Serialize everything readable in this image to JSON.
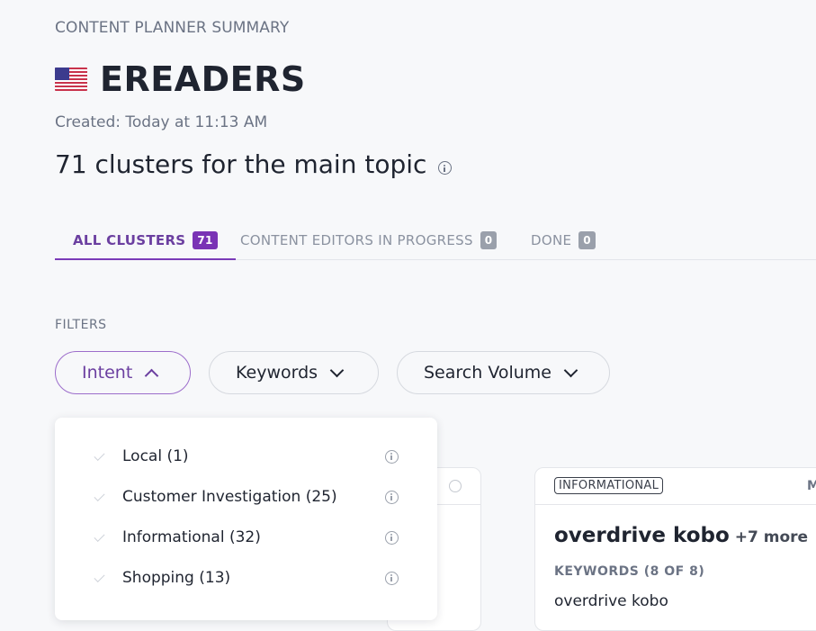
{
  "header": {
    "summary_label": "CONTENT PLANNER SUMMARY",
    "flag_icon": "us-flag-icon",
    "title": "EREADERS",
    "created": "Created: Today at 11:13 AM",
    "clusters_heading": "71 clusters for the main topic"
  },
  "tabs": [
    {
      "label": "ALL CLUSTERS",
      "count": "71",
      "active": true
    },
    {
      "label": "CONTENT EDITORS IN PROGRESS",
      "count": "0",
      "active": false
    },
    {
      "label": "DONE",
      "count": "0",
      "active": false
    }
  ],
  "filters": {
    "label": "FILTERS",
    "buttons": [
      {
        "label": "Intent",
        "open": true
      },
      {
        "label": "Keywords",
        "open": false
      },
      {
        "label": "Search Volume",
        "open": false
      }
    ],
    "intent_options": [
      {
        "label": "Local (1)"
      },
      {
        "label": "Customer Investigation (25)"
      },
      {
        "label": "Informational (32)"
      },
      {
        "label": "Shopping (13)"
      }
    ]
  },
  "card": {
    "intent_tag": "INFORMATIONAL",
    "head_right": "M",
    "title": "overdrive kobo",
    "more": "+7 more",
    "keywords_label": "KEYWORDS (8 OF 8)",
    "first_keyword": "overdrive kobo"
  },
  "colors": {
    "accent": "#7a33b5",
    "background": "#f7f8fa"
  }
}
